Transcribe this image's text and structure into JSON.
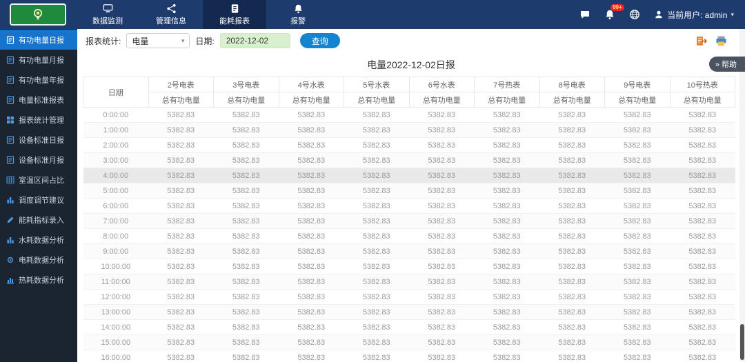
{
  "topbar": {
    "nav": [
      {
        "label": "数据监测",
        "icon": "monitor",
        "active": false
      },
      {
        "label": "管理信息",
        "icon": "share",
        "active": false
      },
      {
        "label": "能耗报表",
        "icon": "document",
        "active": true
      },
      {
        "label": "报警",
        "icon": "alarm",
        "active": false
      }
    ],
    "notifications_badge": "99+",
    "user_label": "当前用户: admin"
  },
  "sidebar": {
    "items": [
      {
        "label": "有功电量日报",
        "icon": "doc",
        "active": true
      },
      {
        "label": "有功电量月报",
        "icon": "doc",
        "active": false
      },
      {
        "label": "有功电量年报",
        "icon": "doc",
        "active": false
      },
      {
        "label": "电量标准报表",
        "icon": "doc",
        "active": false
      },
      {
        "label": "报表统计管理",
        "icon": "grid",
        "active": false
      },
      {
        "label": "设备标准日报",
        "icon": "doc",
        "active": false
      },
      {
        "label": "设备标准月报",
        "icon": "doc",
        "active": false
      },
      {
        "label": "室温区间占比",
        "icon": "table",
        "active": false
      },
      {
        "label": "调度调节建议",
        "icon": "bars",
        "active": false
      },
      {
        "label": "能耗指标录入",
        "icon": "pencil",
        "active": false
      },
      {
        "label": "水耗数据分析",
        "icon": "bars",
        "active": false
      },
      {
        "label": "电耗数据分析",
        "icon": "gear",
        "active": false
      },
      {
        "label": "热耗数据分析",
        "icon": "chart",
        "active": false
      }
    ]
  },
  "toolbar": {
    "report_label": "报表统计:",
    "report_select_value": "电量",
    "date_label": "日期:",
    "date_value": "2022-12-02",
    "query_button": "查询"
  },
  "help_button": "» 帮助",
  "report": {
    "title": "电量2022-12-02日报",
    "date_column_header": "日期",
    "meter_columns": [
      "2号电表",
      "3号电表",
      "4号水表",
      "5号水表",
      "6号水表",
      "7号热表",
      "8号电表",
      "9号电表",
      "10号热表"
    ],
    "sub_header": "总有功电量",
    "times": [
      "0:00:00",
      "1:00:00",
      "2:00:00",
      "3:00:00",
      "4:00:00",
      "5:00:00",
      "6:00:00",
      "7:00:00",
      "8:00:00",
      "9:00:00",
      "10:00:00",
      "11:00:00",
      "12:00:00",
      "13:00:00",
      "14:00:00",
      "15:00:00",
      "16:00:00"
    ],
    "cell_value": "5382.83",
    "highlighted_time": "4:00:00"
  },
  "colors": {
    "topbar": "#1e3b6d",
    "topbar_active_tab": "#14294f",
    "sidebar": "#1b2431",
    "sidebar_active": "#1774cc",
    "accent_blue": "#1584d0",
    "badge_red": "#f5222d",
    "date_input_bg": "#d9f0cf",
    "logo_green": "#1f8a3b"
  }
}
